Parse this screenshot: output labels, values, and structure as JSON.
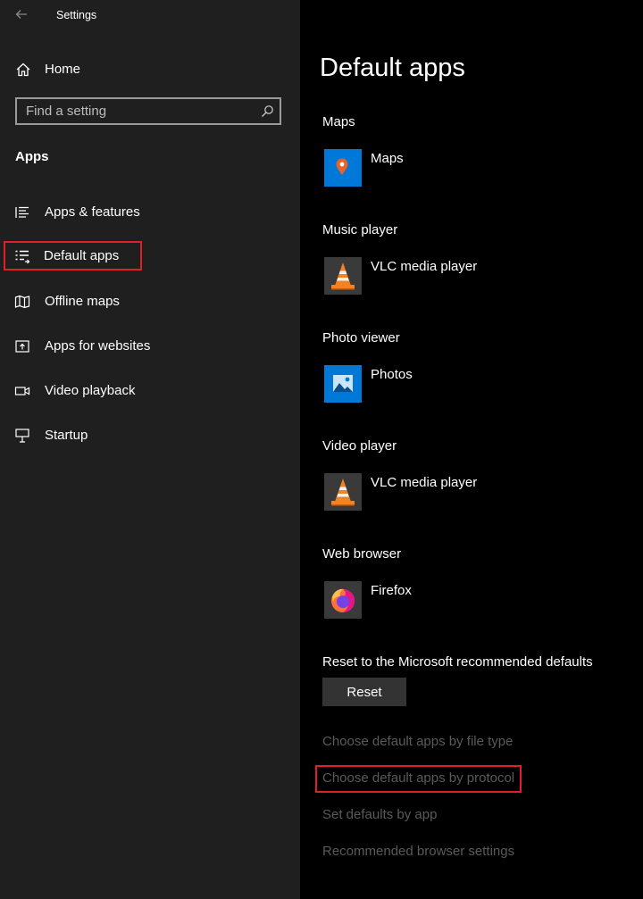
{
  "window": {
    "title": "Settings"
  },
  "sidebar": {
    "home_label": "Home",
    "search_placeholder": "Find a setting",
    "section_heading": "Apps",
    "items": [
      {
        "label": "Apps & features",
        "icon": "list-icon"
      },
      {
        "label": "Default apps",
        "icon": "default-apps-icon",
        "selected": true
      },
      {
        "label": "Offline maps",
        "icon": "map-icon"
      },
      {
        "label": "Apps for websites",
        "icon": "open-website-icon"
      },
      {
        "label": "Video playback",
        "icon": "video-camera-icon"
      },
      {
        "label": "Startup",
        "icon": "startup-icon"
      }
    ]
  },
  "main": {
    "title": "Default apps",
    "categories": [
      {
        "heading": "Maps",
        "app": "Maps",
        "icon": "maps-app-icon"
      },
      {
        "heading": "Music player",
        "app": "VLC media player",
        "icon": "vlc-icon"
      },
      {
        "heading": "Photo viewer",
        "app": "Photos",
        "icon": "photos-app-icon"
      },
      {
        "heading": "Video player",
        "app": "VLC media player",
        "icon": "vlc-icon"
      },
      {
        "heading": "Web browser",
        "app": "Firefox",
        "icon": "firefox-icon"
      }
    ],
    "reset_heading": "Reset to the Microsoft recommended defaults",
    "reset_button": "Reset",
    "links": [
      "Choose default apps by file type",
      "Choose default apps by protocol",
      "Set defaults by app",
      "Recommended browser settings"
    ]
  },
  "colors": {
    "sidebar_bg": "#1f1f1f",
    "main_bg": "#000000",
    "highlight_red": "#e01f26",
    "link_gray": "#5a5a5a",
    "tile_blue": "#0078d7"
  }
}
